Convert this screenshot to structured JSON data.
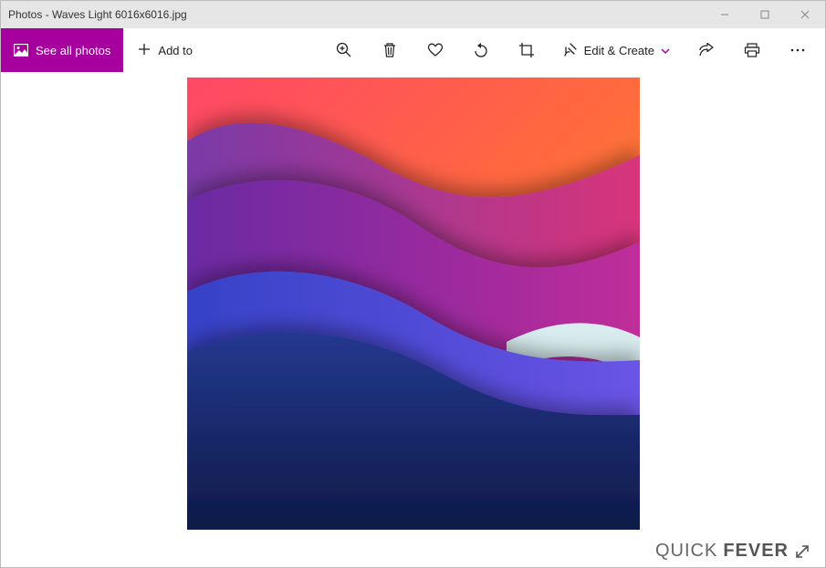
{
  "window": {
    "title": "Photos - Waves Light 6016x6016.jpg"
  },
  "toolbar": {
    "see_all_label": "See all photos",
    "add_to_label": "Add to",
    "edit_create_label": "Edit & Create"
  },
  "watermark": {
    "part1": "QUICK",
    "part2": "FEVER"
  },
  "icons": {
    "picture": "picture-icon",
    "plus": "plus-icon",
    "zoom": "zoom-icon",
    "trash": "trash-icon",
    "heart": "heart-icon",
    "rotate": "rotate-icon",
    "crop": "crop-icon",
    "edit": "edit-icon",
    "chevron": "chevron-down-icon",
    "share": "share-icon",
    "print": "print-icon",
    "more": "more-icon",
    "minimize": "minimize-icon",
    "maximize": "maximize-icon",
    "close": "close-icon",
    "expand": "expand-icon"
  }
}
